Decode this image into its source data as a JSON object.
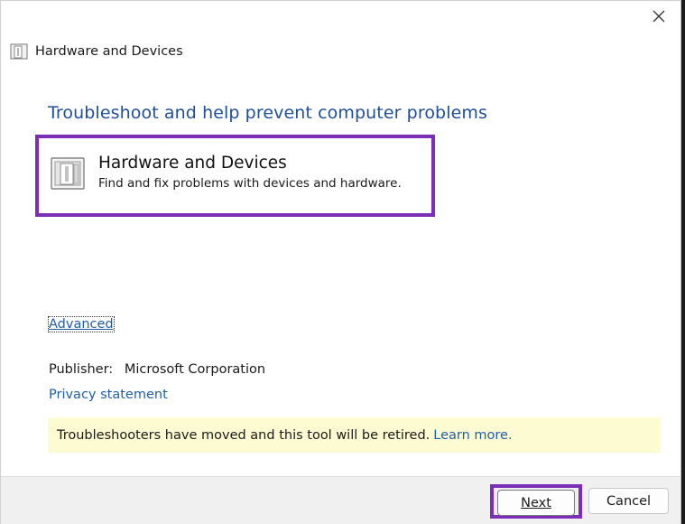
{
  "window": {
    "title": "Hardware and Devices",
    "close_glyph": "✕"
  },
  "main": {
    "heading": "Troubleshoot and help prevent computer problems",
    "task": {
      "title": "Hardware and Devices",
      "description": "Find and fix problems with devices and hardware."
    },
    "advanced_link": "Advanced",
    "publisher_label": "Publisher:",
    "publisher_value": "Microsoft Corporation",
    "privacy_link": "Privacy statement",
    "notice": {
      "text": "Troubleshooters have moved and this tool will be retired.",
      "link": "Learn more."
    }
  },
  "footer": {
    "next_label": "Next",
    "cancel_label": "Cancel"
  },
  "colors": {
    "accent_highlight": "#7b2fb8",
    "heading_blue": "#1f4e9a",
    "link_blue": "#1f5fa8",
    "notice_bg": "#fdfbd2"
  },
  "icons": [
    "close-icon",
    "hardware-device-icon"
  ]
}
